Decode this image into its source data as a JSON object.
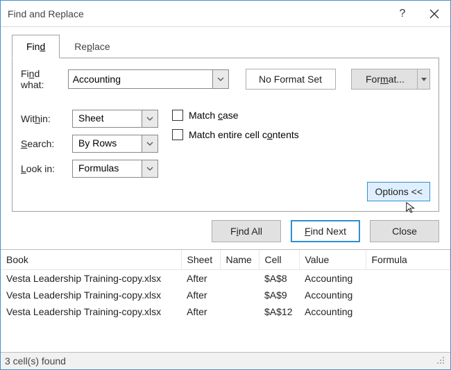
{
  "window": {
    "title": "Find and Replace"
  },
  "tabs": {
    "find": "Find",
    "replace": "Replace"
  },
  "findwhat": {
    "label": "Find what:",
    "value": "Accounting"
  },
  "format": {
    "noformat": "No Format Set",
    "button": "Format..."
  },
  "within": {
    "label": "Within:",
    "value": "Sheet"
  },
  "search": {
    "label": "Search:",
    "value": "By Rows"
  },
  "lookin": {
    "label": "Look in:",
    "value": "Formulas"
  },
  "checks": {
    "matchcase": "Match case",
    "entire": "Match entire cell contents"
  },
  "optionsBtn": "Options <<",
  "actions": {
    "findall": "Find All",
    "findnext": "Find Next",
    "close": "Close"
  },
  "headers": {
    "book": "Book",
    "sheet": "Sheet",
    "name": "Name",
    "cell": "Cell",
    "value": "Value",
    "formula": "Formula"
  },
  "rows": [
    {
      "book": "Vesta Leadership Training-copy.xlsx",
      "sheet": "After",
      "name": "",
      "cell": "$A$8",
      "value": "Accounting",
      "formula": ""
    },
    {
      "book": "Vesta Leadership Training-copy.xlsx",
      "sheet": "After",
      "name": "",
      "cell": "$A$9",
      "value": "Accounting",
      "formula": ""
    },
    {
      "book": "Vesta Leadership Training-copy.xlsx",
      "sheet": "After",
      "name": "",
      "cell": "$A$12",
      "value": "Accounting",
      "formula": ""
    }
  ],
  "status": "3 cell(s) found"
}
